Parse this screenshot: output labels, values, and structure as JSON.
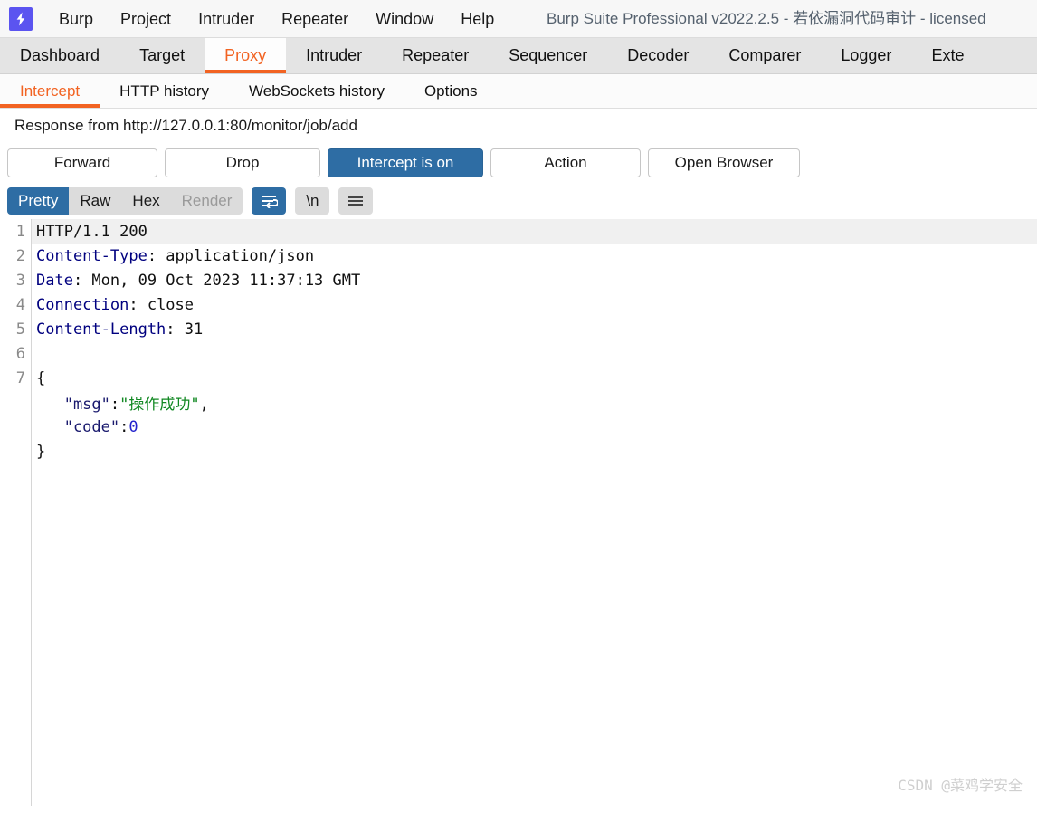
{
  "window": {
    "title": "Burp Suite Professional v2022.2.5 - 若依漏洞代码审计 - licensed",
    "logo_icon": "burp-lightning-icon"
  },
  "menu": {
    "items": [
      {
        "label": "Burp"
      },
      {
        "label": "Project"
      },
      {
        "label": "Intruder"
      },
      {
        "label": "Repeater"
      },
      {
        "label": "Window"
      },
      {
        "label": "Help"
      }
    ]
  },
  "main_tabs": {
    "active": "Proxy",
    "items": [
      {
        "label": "Dashboard"
      },
      {
        "label": "Target"
      },
      {
        "label": "Proxy"
      },
      {
        "label": "Intruder"
      },
      {
        "label": "Repeater"
      },
      {
        "label": "Sequencer"
      },
      {
        "label": "Decoder"
      },
      {
        "label": "Comparer"
      },
      {
        "label": "Logger"
      },
      {
        "label": "Exte"
      }
    ]
  },
  "sub_tabs": {
    "active": "Intercept",
    "items": [
      {
        "label": "Intercept"
      },
      {
        "label": "HTTP history"
      },
      {
        "label": "WebSockets history"
      },
      {
        "label": "Options"
      }
    ]
  },
  "intercept": {
    "request_line": "Response from http://127.0.0.1:80/monitor/job/add",
    "buttons": {
      "forward": "Forward",
      "drop": "Drop",
      "intercept_toggle": "Intercept is on",
      "action": "Action",
      "open_browser": "Open Browser"
    }
  },
  "editor_toolbar": {
    "views": [
      {
        "label": "Pretty",
        "state": "active"
      },
      {
        "label": "Raw",
        "state": "normal"
      },
      {
        "label": "Hex",
        "state": "normal"
      },
      {
        "label": "Render",
        "state": "disabled"
      }
    ],
    "icons": {
      "wrap": "word-wrap-icon",
      "newline": "\\n",
      "menu": "hamburger-menu-icon"
    }
  },
  "response": {
    "lines": [
      {
        "no": "1",
        "parts": [
          {
            "t": "HTTP/1.1 200",
            "c": "hdr-val"
          }
        ]
      },
      {
        "no": "2",
        "parts": [
          {
            "t": "Content-Type",
            "c": "hdr-name"
          },
          {
            "t": ": application/json",
            "c": "hdr-val"
          }
        ]
      },
      {
        "no": "3",
        "parts": [
          {
            "t": "Date",
            "c": "hdr-name"
          },
          {
            "t": ": Mon, 09 Oct 2023 11:37:13 GMT",
            "c": "hdr-val"
          }
        ]
      },
      {
        "no": "4",
        "parts": [
          {
            "t": "Connection",
            "c": "hdr-name"
          },
          {
            "t": ": close",
            "c": "hdr-val"
          }
        ]
      },
      {
        "no": "5",
        "parts": [
          {
            "t": "Content-Length",
            "c": "hdr-name"
          },
          {
            "t": ": 31",
            "c": "hdr-val"
          }
        ]
      },
      {
        "no": "6",
        "parts": []
      },
      {
        "no": "7",
        "parts": [
          {
            "t": "{",
            "c": "j-punc"
          }
        ]
      },
      {
        "no": "",
        "parts": [
          {
            "t": "   \"msg\"",
            "c": "j-key"
          },
          {
            "t": ":",
            "c": "j-punc"
          },
          {
            "t": "\"操作成功\"",
            "c": "j-str"
          },
          {
            "t": ",",
            "c": "j-punc"
          }
        ]
      },
      {
        "no": "",
        "parts": [
          {
            "t": "   \"code\"",
            "c": "j-key"
          },
          {
            "t": ":",
            "c": "j-punc"
          },
          {
            "t": "0",
            "c": "j-num"
          }
        ]
      },
      {
        "no": "",
        "parts": [
          {
            "t": "}",
            "c": "j-punc"
          }
        ]
      }
    ]
  },
  "watermark": {
    "text": "CSDN @菜鸡学安全"
  },
  "colors": {
    "accent_orange": "#f26322",
    "primary_blue": "#2e6da4",
    "logo_purple": "#5b54f0",
    "header_name": "#00007f",
    "json_string": "#118822",
    "json_number": "#2222cc"
  }
}
